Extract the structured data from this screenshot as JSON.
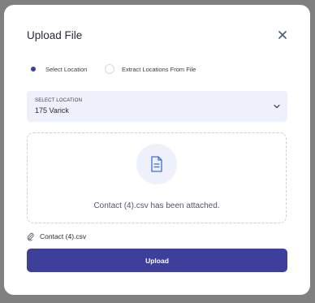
{
  "dialog": {
    "title": "Upload File",
    "close_icon": "close-icon"
  },
  "options": {
    "items": [
      {
        "label": "Select Location",
        "selected": true
      },
      {
        "label": "Extract Locations From File",
        "selected": false
      }
    ]
  },
  "location_select": {
    "label": "SELECT LOCATION",
    "value": "175 Varick",
    "icon": "chevron-down-icon"
  },
  "dropzone": {
    "icon": "document-icon",
    "message": "Contact (4).csv has been attached."
  },
  "attachment": {
    "icon": "paperclip-icon",
    "filename": "Contact (4).csv"
  },
  "actions": {
    "upload_label": "Upload"
  },
  "colors": {
    "primary": "#3d3f9b",
    "field_background": "#eef1fb"
  }
}
